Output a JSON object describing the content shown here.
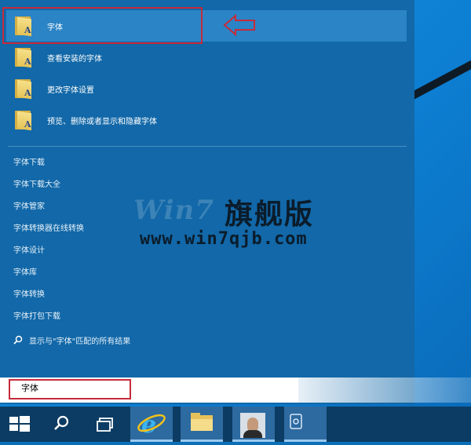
{
  "start_menu": {
    "best_matches": [
      {
        "label": "字体",
        "icon": "font-folder-icon",
        "selected": true
      },
      {
        "label": "查看安装的字体",
        "icon": "font-folder-icon"
      },
      {
        "label": "更改字体设置",
        "icon": "font-folder-icon"
      },
      {
        "label": "预览、删除或者显示和隐藏字体",
        "icon": "font-folder-icon"
      }
    ],
    "suggestions": [
      {
        "label": "字体下载"
      },
      {
        "label": "字体下载大全"
      },
      {
        "label": "字体管家"
      },
      {
        "label": "字体转换器在线转换"
      },
      {
        "label": "字体设计"
      },
      {
        "label": "字体库"
      },
      {
        "label": "字体转换"
      },
      {
        "label": "字体打包下载"
      }
    ],
    "see_all": "显示与\"字体\"匹配的所有结果"
  },
  "search": {
    "value": "字体"
  },
  "watermark": {
    "brand": "Win7",
    "title": "旗舰版",
    "url": "www.win7qjb.com"
  },
  "taskbar": {
    "items": [
      "windows-logo-icon",
      "search-icon",
      "task-view-icon",
      "internet-explorer-icon",
      "file-explorer-icon",
      "user-photo",
      "app-icon"
    ]
  },
  "colors": {
    "accent": "#1268a8",
    "highlight": "#c62b3a",
    "taskbar": "#0c3c63"
  }
}
